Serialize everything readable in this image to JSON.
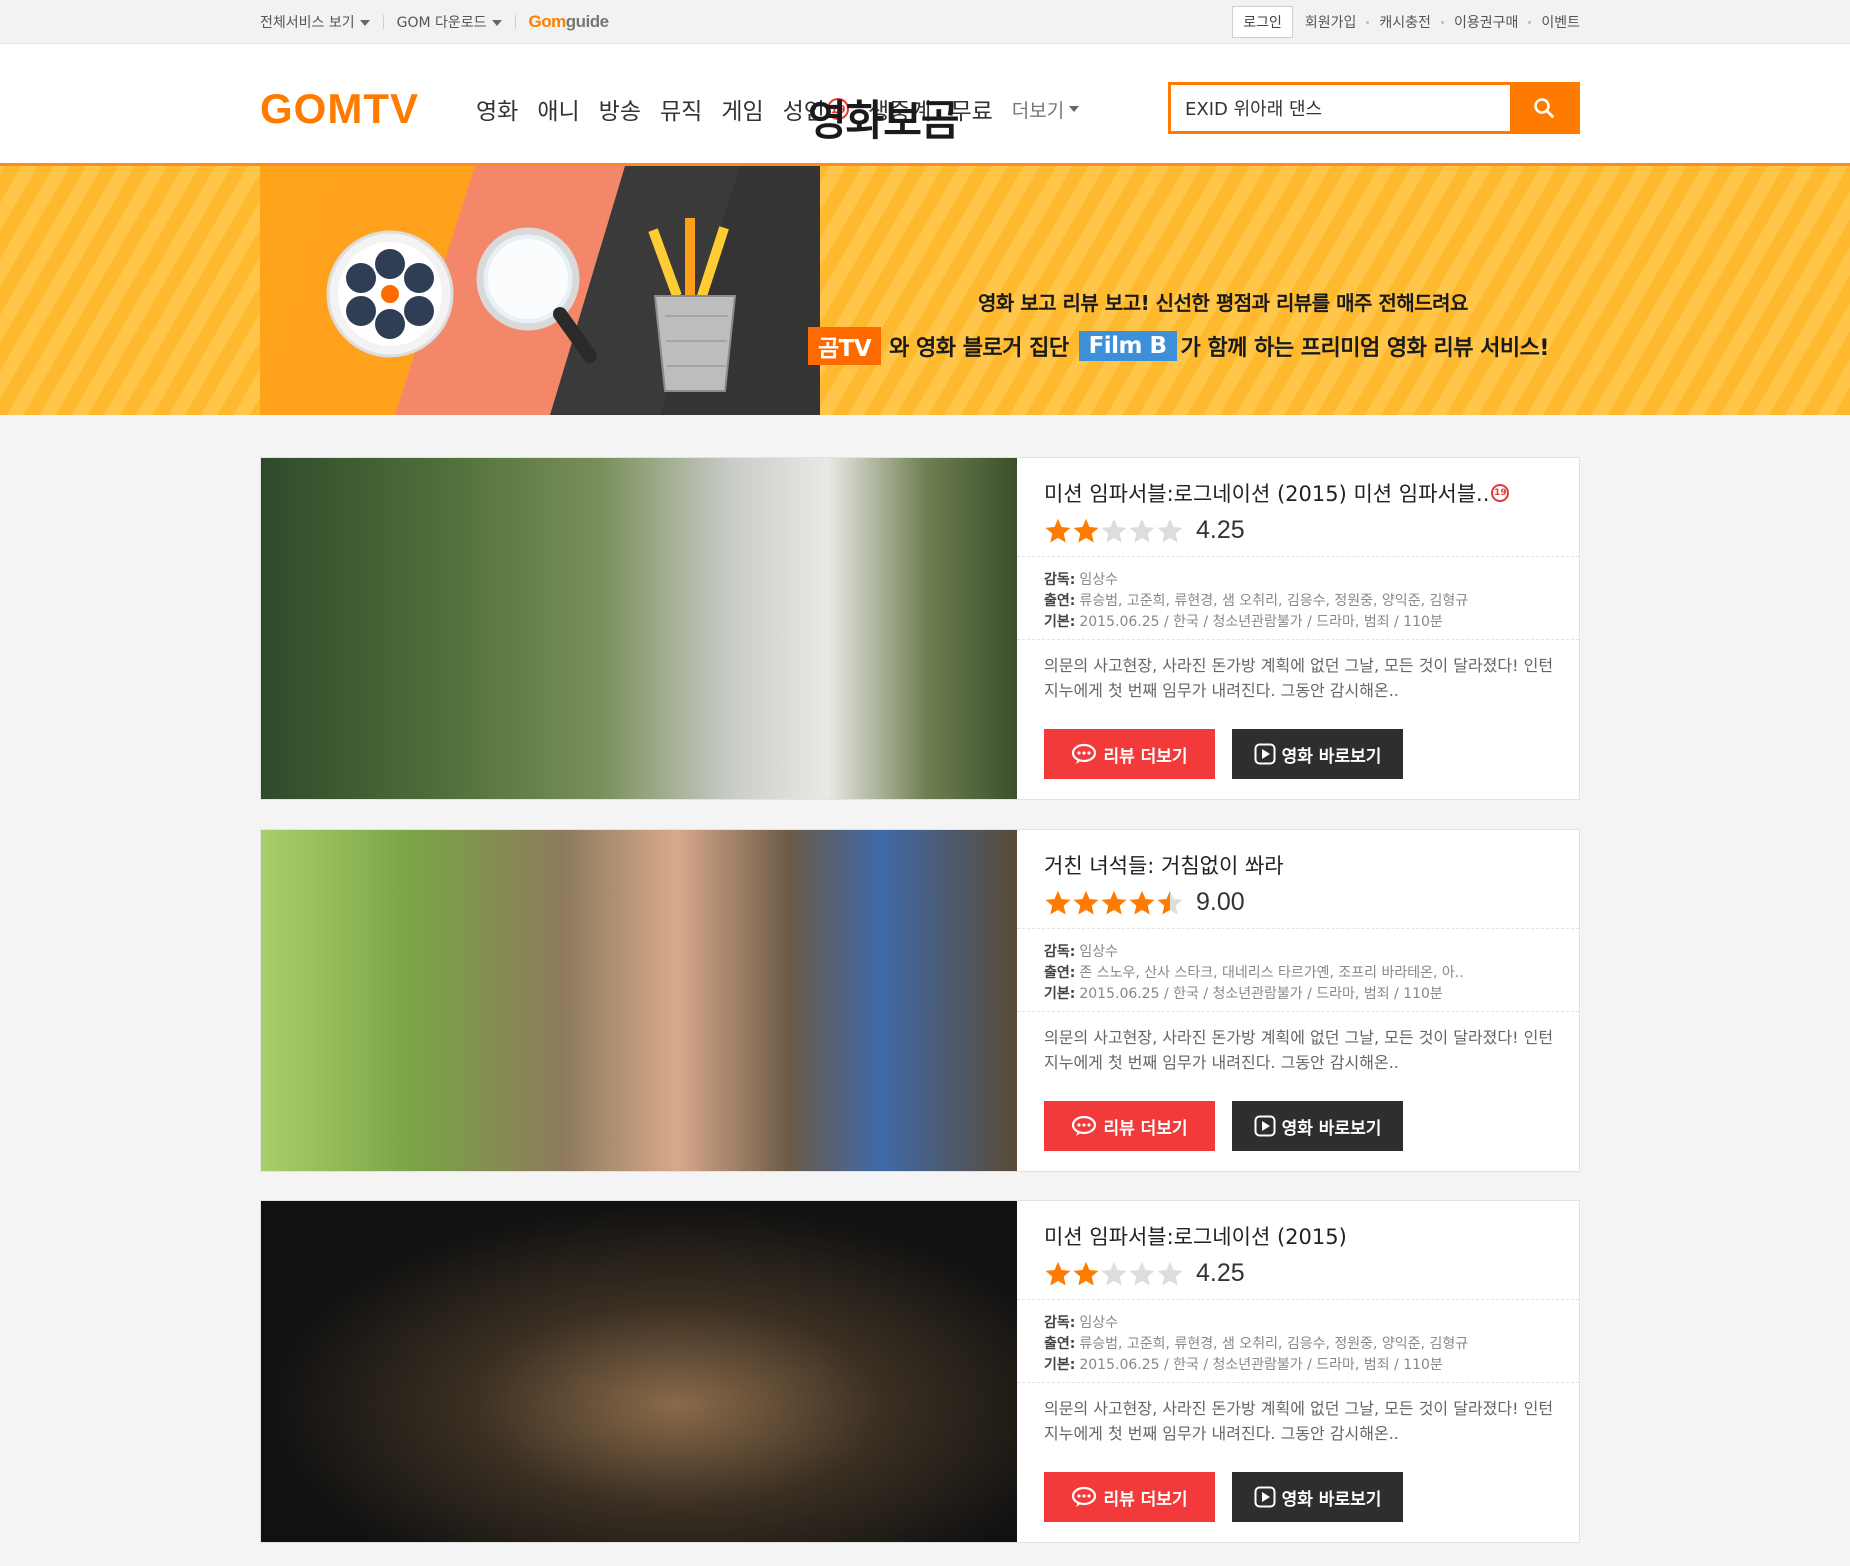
{
  "topbar": {
    "all_services": "전체서비스 보기",
    "download": "GOM 다운로드",
    "guide_a": "Gom",
    "guide_b": "guide",
    "login": "로그인",
    "signup": "회원가입",
    "cash": "캐시충전",
    "ticket": "이용권구매",
    "event": "이벤트"
  },
  "header": {
    "logo": "GOMTV",
    "nav": [
      "영화",
      "애니",
      "방송",
      "뮤직",
      "게임",
      "성인",
      "생중계",
      "무료"
    ],
    "adult_badge": "19",
    "more": "더보기",
    "search_value": "EXID 위아래 댄스"
  },
  "banner": {
    "title": "영화보곰",
    "subtitle": "영화 보고 리뷰 보고! 신선한 평점과 리뷰를 매주 전해드려요",
    "tag_gom": "곰TV",
    "text_mid": "와 영화 블로거 집단",
    "tag_filmb": "Film B",
    "text_end": "가 함께 하는 프리미엄 영화 리뷰 서비스!"
  },
  "labels": {
    "director": "감독:",
    "cast": "출연:",
    "basic": "기본:",
    "review_btn": "리뷰 더보기",
    "watch_btn": "영화 바로보기"
  },
  "movies": [
    {
      "title": "미션 임파서블:로그네이션 (2015) 미션 임파서블..",
      "adult_badge": "19",
      "rating": "4.25",
      "stars": 2,
      "director": "임상수",
      "cast": "류승범, 고준희, 류현경, 샘 오취리, 김응수, 정원중, 양익준, 김형규",
      "basic": "2015.06.25 / 한국 / 청소년관람불가 / 드라마, 범죄 / 110분",
      "synopsis": "의문의 사고현장, 사라진 돈가방 계획에 없던 그날, 모든 것이 달라졌다! 인턴 지누에게 첫 번째 임무가 내려진다. 그동안 감시해온.."
    },
    {
      "title": "거친 녀석들: 거침없이 쏴라",
      "rating": "9.00",
      "stars": 4.5,
      "director": "임상수",
      "cast": "존 스노우, 산사 스타크, 대네리스 타르가옌, 조프리 바라테온, 아..",
      "basic": "2015.06.25 / 한국 / 청소년관람불가 / 드라마, 범죄 / 110분",
      "synopsis": "의문의 사고현장, 사라진 돈가방 계획에 없던 그날, 모든 것이 달라졌다! 인턴 지누에게 첫 번째 임무가 내려진다. 그동안 감시해온.."
    },
    {
      "title": "미션 임파서블:로그네이션 (2015)",
      "rating": "4.25",
      "stars": 2,
      "director": "임상수",
      "cast": "류승범, 고준희, 류현경, 샘 오취리, 김응수, 정원중, 양익준, 김형규",
      "basic": "2015.06.25 / 한국 / 청소년관람불가 / 드라마, 범죄 / 110분",
      "synopsis": "의문의 사고현장, 사라진 돈가방 계획에 없던 그날, 모든 것이 달라졌다! 인턴 지누에게 첫 번째 임무가 내려진다. 그동안 감시해온.."
    }
  ],
  "colors": {
    "brand_orange": "#ff7b00",
    "review_red": "#f23a3a",
    "watch_dark": "#2e2e2e",
    "star_on": "#ff7b00",
    "star_off": "#dddddd"
  }
}
